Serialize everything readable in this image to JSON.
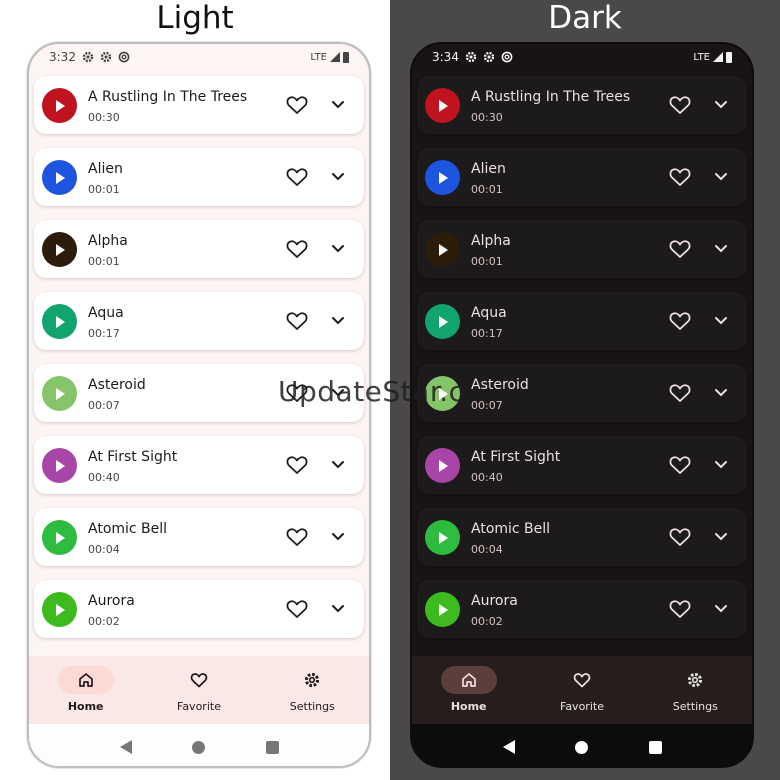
{
  "light": {
    "caption": "Light",
    "status": {
      "time": "3:32",
      "network": "LTE"
    },
    "tracks": [
      {
        "title": "A Rustling In The Trees",
        "duration": "00:30",
        "color": "#c0121f"
      },
      {
        "title": "Alien",
        "duration": "00:01",
        "color": "#1d55e0"
      },
      {
        "title": "Alpha",
        "duration": "00:01",
        "color": "#2b1c0b"
      },
      {
        "title": "Aqua",
        "duration": "00:17",
        "color": "#13a36f"
      },
      {
        "title": "Asteroid",
        "duration": "00:07",
        "color": "#86c46a"
      },
      {
        "title": "At First Sight",
        "duration": "00:40",
        "color": "#a746a7"
      },
      {
        "title": "Atomic Bell",
        "duration": "00:04",
        "color": "#2dbc3f"
      },
      {
        "title": "Aurora",
        "duration": "00:02",
        "color": "#3dbb1e"
      }
    ],
    "nav": [
      {
        "label": "Home",
        "icon": "home-icon",
        "active": true
      },
      {
        "label": "Favorite",
        "icon": "heart-icon",
        "active": false
      },
      {
        "label": "Settings",
        "icon": "gear-icon",
        "active": false
      }
    ]
  },
  "dark": {
    "caption": "Dark",
    "status": {
      "time": "3:34",
      "network": "LTE"
    },
    "tracks": [
      {
        "title": "A Rustling In The Trees",
        "duration": "00:30",
        "color": "#c0121f"
      },
      {
        "title": "Alien",
        "duration": "00:01",
        "color": "#1d55e0"
      },
      {
        "title": "Alpha",
        "duration": "00:01",
        "color": "#2b1c0b"
      },
      {
        "title": "Aqua",
        "duration": "00:17",
        "color": "#13a36f"
      },
      {
        "title": "Asteroid",
        "duration": "00:07",
        "color": "#86c46a"
      },
      {
        "title": "At First Sight",
        "duration": "00:40",
        "color": "#a746a7"
      },
      {
        "title": "Atomic Bell",
        "duration": "00:04",
        "color": "#2dbc3f"
      },
      {
        "title": "Aurora",
        "duration": "00:02",
        "color": "#3dbb1e"
      }
    ],
    "nav": [
      {
        "label": "Home",
        "icon": "home-icon",
        "active": true
      },
      {
        "label": "Favorite",
        "icon": "heart-icon",
        "active": false
      },
      {
        "label": "Settings",
        "icon": "gear-icon",
        "active": false
      }
    ]
  },
  "watermark": "UpdateStar.c"
}
